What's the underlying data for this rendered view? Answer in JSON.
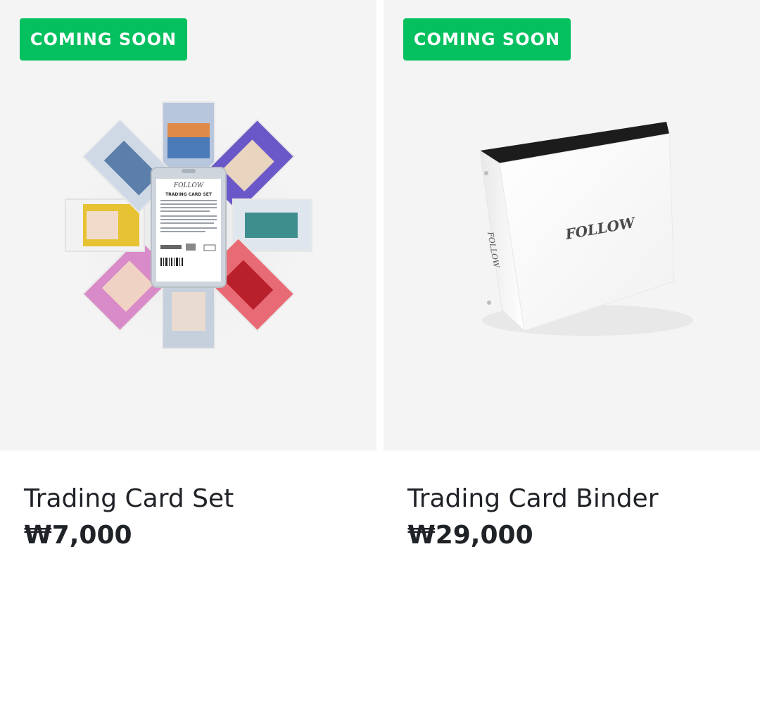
{
  "products": [
    {
      "badge": "COMING SOON",
      "name": "Trading Card Set",
      "price": "₩7,000",
      "image_icon": "trading-card-set-image",
      "package_title": "TRADING CARD SET"
    },
    {
      "badge": "COMING SOON",
      "name": "Trading Card Binder",
      "price": "₩29,000",
      "image_icon": "trading-card-binder-image"
    }
  ],
  "colors": {
    "badge_bg": "#04c05f",
    "thumb_bg": "#f4f4f4",
    "text": "#1f2226"
  }
}
